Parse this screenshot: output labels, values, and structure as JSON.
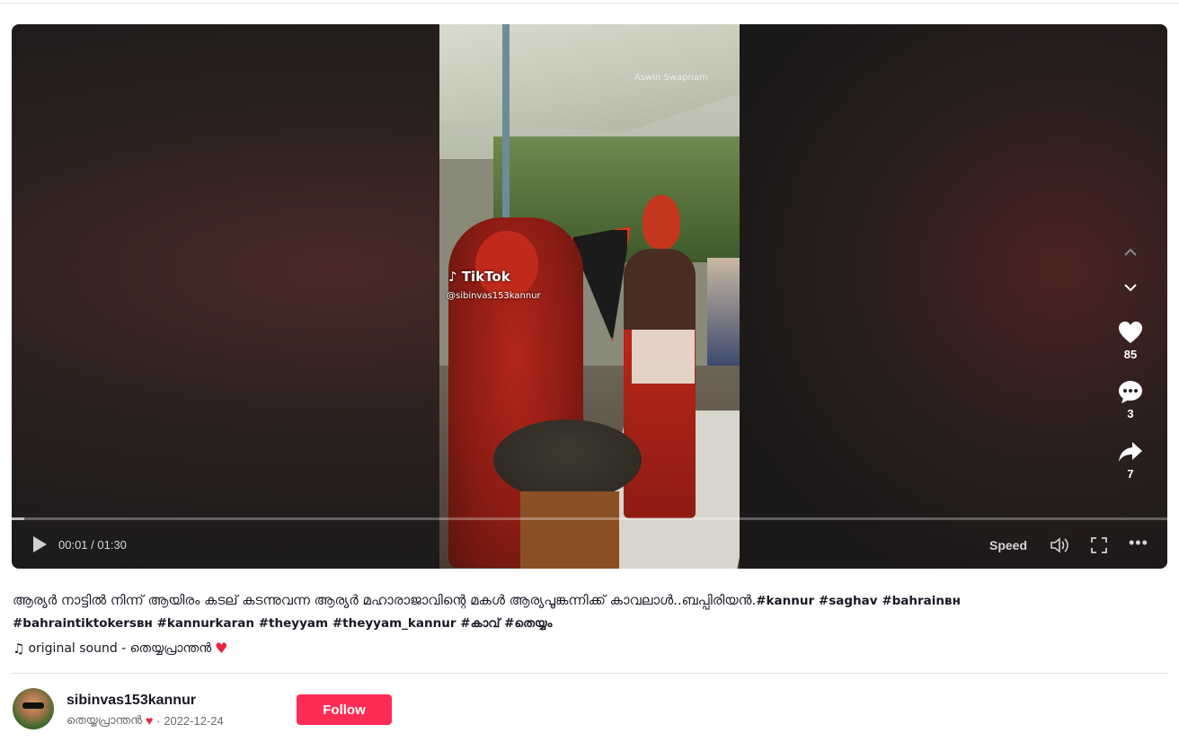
{
  "video": {
    "watermark": "Aswin Swapnam",
    "tiktok_logo": "TikTok",
    "tiktok_user": "@sibinvas153kannur",
    "time": "00:01 / 01:30",
    "speed_label": "Speed",
    "progress_fraction": 0.011
  },
  "actions": {
    "likes": "85",
    "comments": "3",
    "shares": "7"
  },
  "caption": {
    "text": "ആര്യർ നാട്ടിൽ നിന്ന് ആയിരം കടല് കടന്നുവന്ന ആര്യർ മഹാരാജാവിന്റെ മകൾ ആര്യപൂങ്കന്നിക്ക് കാവലാൾ..ബപ്പിരിയൻ.",
    "tags": [
      "#kannur",
      "#saghav",
      "#bahrainʙʜ",
      "#bahraintiktokersʙʜ",
      "#kannurkaran",
      "#theyyam",
      "#theyyam_kannur",
      "#കാവ്",
      "#തെയ്യം"
    ]
  },
  "sound": {
    "label": "original sound - തെയ്യപ്രാന്തൻ",
    "heart": "♥"
  },
  "author": {
    "username": "sibinvas153kannur",
    "nickname": "തെയ്യപ്രാന്തൻ",
    "date": "· 2022-12-24",
    "follow_label": "Follow"
  },
  "colors": {
    "accent": "#fe2c55",
    "heart": "#fe2c55"
  }
}
